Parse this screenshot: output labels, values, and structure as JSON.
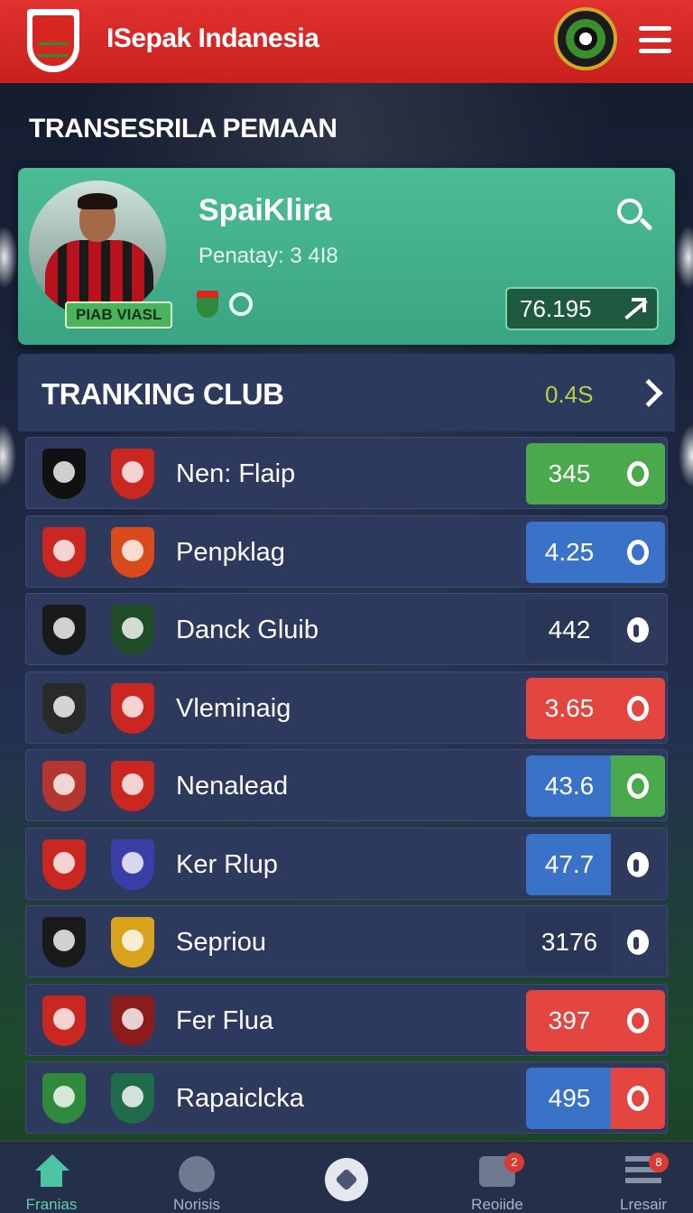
{
  "header": {
    "app_title": "ISepak Indanesia",
    "logo_icon": "club-crest-icon",
    "badge_icon": "league-badge-icon",
    "menu_icon": "hamburger-menu-icon"
  },
  "section_title": "TRANSESRILA PEMAAN",
  "featured_player": {
    "name": "SpaiKlira",
    "subtitle": "Penatay: 3 4I8",
    "tag": "PIAB VIASL",
    "value": "76.195",
    "icons": [
      "search-icon",
      "trend-up-icon"
    ]
  },
  "ranking": {
    "title": "TRANKING CLUB",
    "meta": "0.4S",
    "clubs": [
      {
        "name": "Nen: Flaip",
        "score": "345",
        "box_color": "#49a94b",
        "indicator_color": "#49a94b",
        "indicator": "ring",
        "crest1": "#111",
        "crest2": "#c9271f"
      },
      {
        "name": "Penpklag",
        "score": "4.25",
        "box_color": "#3a72c8",
        "indicator_color": "#3a72c8",
        "indicator": "ring",
        "crest1": "#c9271f",
        "crest2": "#d94b1c"
      },
      {
        "name": "Danck Gluib",
        "score": "442",
        "box_color": "#2a3658",
        "indicator_color": "#2e3a5d",
        "indicator": "solid",
        "crest1": "#1a1a1a",
        "crest2": "#1f4d2a"
      },
      {
        "name": "Vleminaig",
        "score": "3.65",
        "box_color": "#e4453f",
        "indicator_color": "#e4453f",
        "indicator": "ring",
        "crest1": "#2a2a2a",
        "crest2": "#c9271f"
      },
      {
        "name": "Nenalead",
        "score": "43.6",
        "box_color": "#3a72c8",
        "indicator_color": "#49a94b",
        "indicator": "ring",
        "crest1": "#b5352f",
        "crest2": "#c9271f"
      },
      {
        "name": "Ker Rlup",
        "score": "47.7",
        "box_color": "#3a72c8",
        "indicator_color": "#2e3a5d",
        "indicator": "solid",
        "crest1": "#c9271f",
        "crest2": "#3a3fa8"
      },
      {
        "name": "Sepriou",
        "score": "3176",
        "box_color": "#2a3658",
        "indicator_color": "#2e3a5d",
        "indicator": "solid",
        "crest1": "#1a1a1a",
        "crest2": "#d9a21c"
      },
      {
        "name": "Fer Flua",
        "score": "397",
        "box_color": "#e4453f",
        "indicator_color": "#e4453f",
        "indicator": "ring",
        "crest1": "#c9271f",
        "crest2": "#8a1c1c"
      },
      {
        "name": "Rapaiclcka",
        "score": "495",
        "box_color": "#3a72c8",
        "indicator_color": "#e4453f",
        "indicator": "ring",
        "crest1": "#2f8a3c",
        "crest2": "#1f6b4a"
      }
    ]
  },
  "bottom_nav": {
    "items": [
      {
        "label": "Franias",
        "icon": "home-icon",
        "active": true
      },
      {
        "label": "Norisis",
        "icon": "globe-icon",
        "active": false
      },
      {
        "label": "",
        "icon": "soccer-ball-icon",
        "active": false
      },
      {
        "label": "Reoiide",
        "icon": "chat-icon",
        "badge": "2",
        "active": false
      },
      {
        "label": "Lresair",
        "icon": "list-icon",
        "badge": "8",
        "active": false
      }
    ]
  }
}
